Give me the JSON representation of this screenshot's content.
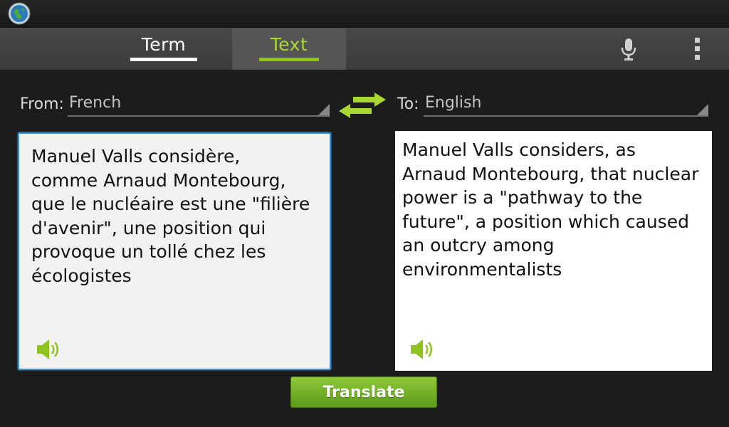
{
  "tabs": {
    "term": "Term",
    "text": "Text"
  },
  "from": {
    "label": "From:",
    "language": "French"
  },
  "to": {
    "label": "To:",
    "language": "English"
  },
  "source_text": "Manuel Valls considère,\ncomme Arnaud Montebourg,\nque le nucléaire est une \"filière\nd'avenir\", une position qui\nprovoque un tollé chez les\nécologistes",
  "translated_text": "Manuel Valls considers, as\nArnaud Montebourg, that nuclear\npower is a \"pathway to the\nfuture\", a position which caused\nan outcry among\nenvironmentalists",
  "translate_button": "Translate",
  "colors": {
    "accent": "#a9d832",
    "focus_border": "#2f8fd8"
  },
  "icons": {
    "app": "globe-icon",
    "mic": "microphone-icon",
    "overflow": "overflow-menu-icon",
    "swap": "swap-languages-icon",
    "speaker": "speaker-icon"
  }
}
